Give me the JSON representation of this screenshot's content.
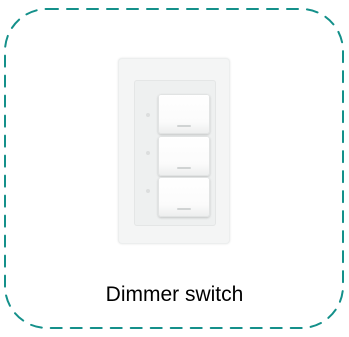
{
  "card": {
    "label": "Dimmer switch",
    "border_color": "#14908a"
  },
  "image": {
    "subject": "dimmer-switch",
    "switch_count": 3
  }
}
